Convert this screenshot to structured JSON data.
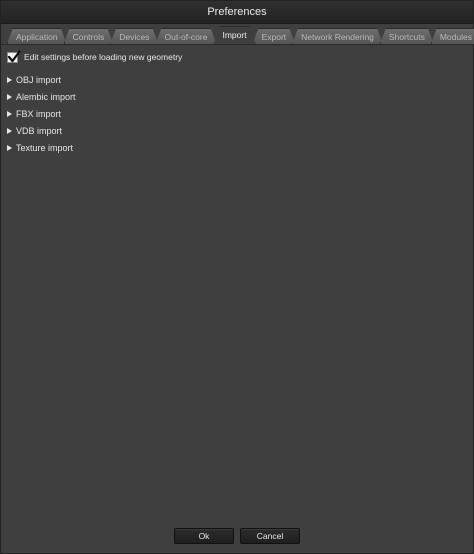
{
  "window": {
    "title": "Preferences"
  },
  "tabs": [
    {
      "label": "Application",
      "active": false
    },
    {
      "label": "Controls",
      "active": false
    },
    {
      "label": "Devices",
      "active": false
    },
    {
      "label": "Out-of-core",
      "active": false
    },
    {
      "label": "Import",
      "active": true
    },
    {
      "label": "Export",
      "active": false
    },
    {
      "label": "Network Rendering",
      "active": false
    },
    {
      "label": "Shortcuts",
      "active": false
    },
    {
      "label": "Modules",
      "active": false
    }
  ],
  "import": {
    "edit_settings_label": "Edit settings before loading new geometry",
    "edit_settings_checked": true,
    "sections": [
      {
        "label": "OBJ import",
        "icon": "triangle-right-icon"
      },
      {
        "label": "Alembic import",
        "icon": "triangle-right-icon"
      },
      {
        "label": "FBX import",
        "icon": "triangle-right-icon"
      },
      {
        "label": "VDB import",
        "icon": "triangle-right-icon"
      },
      {
        "label": "Texture import",
        "icon": "triangle-right-icon"
      }
    ]
  },
  "footer": {
    "ok_label": "Ok",
    "cancel_label": "Cancel"
  }
}
